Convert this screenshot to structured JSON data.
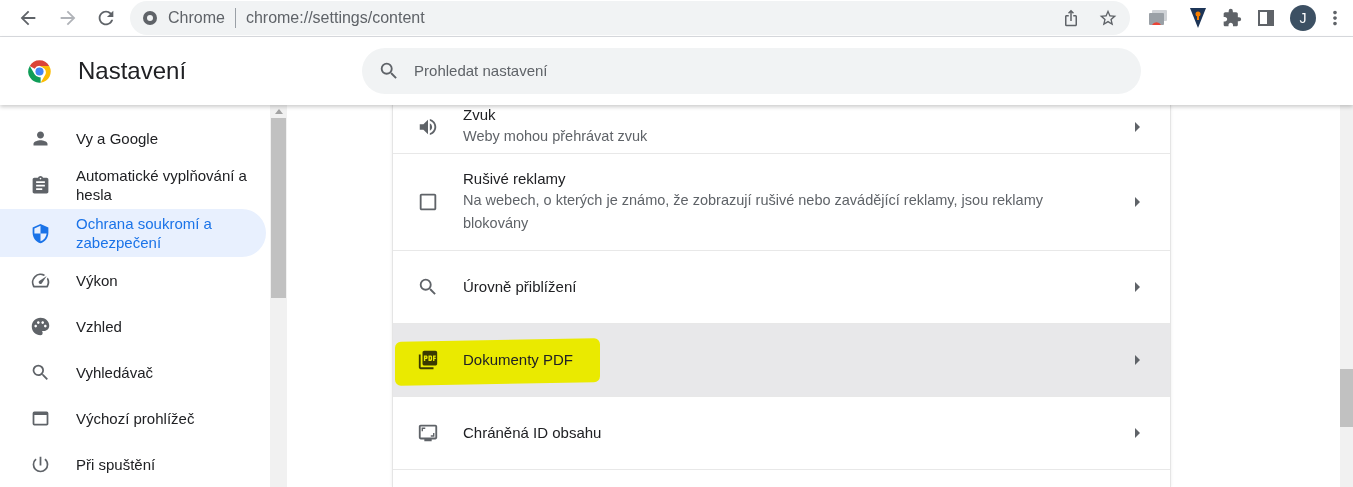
{
  "toolbar": {
    "site_label": "Chrome",
    "url": "chrome://settings/content",
    "avatar": "J"
  },
  "header": {
    "title": "Nastavení",
    "search": {
      "placeholder": "Prohledat nastavení"
    }
  },
  "sidebar": {
    "items": [
      {
        "label": "Vy a Google",
        "selected": false
      },
      {
        "label": "Automatické vyplňování a hesla",
        "selected": false
      },
      {
        "label": "Ochrana soukromí a zabezpečení",
        "selected": true
      },
      {
        "label": "Výkon",
        "selected": false
      },
      {
        "label": "Vzhled",
        "selected": false
      },
      {
        "label": "Vyhledávač",
        "selected": false
      },
      {
        "label": "Výchozí prohlížeč",
        "selected": false
      },
      {
        "label": "Při spuštění",
        "selected": false
      }
    ]
  },
  "content": {
    "rows": [
      {
        "title": "Zvuk",
        "subtitle": "Weby mohou přehrávat zvuk",
        "hovered": false,
        "marked": false
      },
      {
        "title": "Rušivé reklamy",
        "subtitle": "Na webech, o kterých je známo, že zobrazují rušivé nebo zavádějící reklamy, jsou reklamy blokovány",
        "hovered": false,
        "marked": false
      },
      {
        "title": "Úrovně přiblížení",
        "hovered": false,
        "marked": false
      },
      {
        "title": "Dokumenty PDF",
        "hovered": true,
        "marked": true
      },
      {
        "title": "Chráněná ID obsahu",
        "hovered": false,
        "marked": false
      }
    ]
  }
}
